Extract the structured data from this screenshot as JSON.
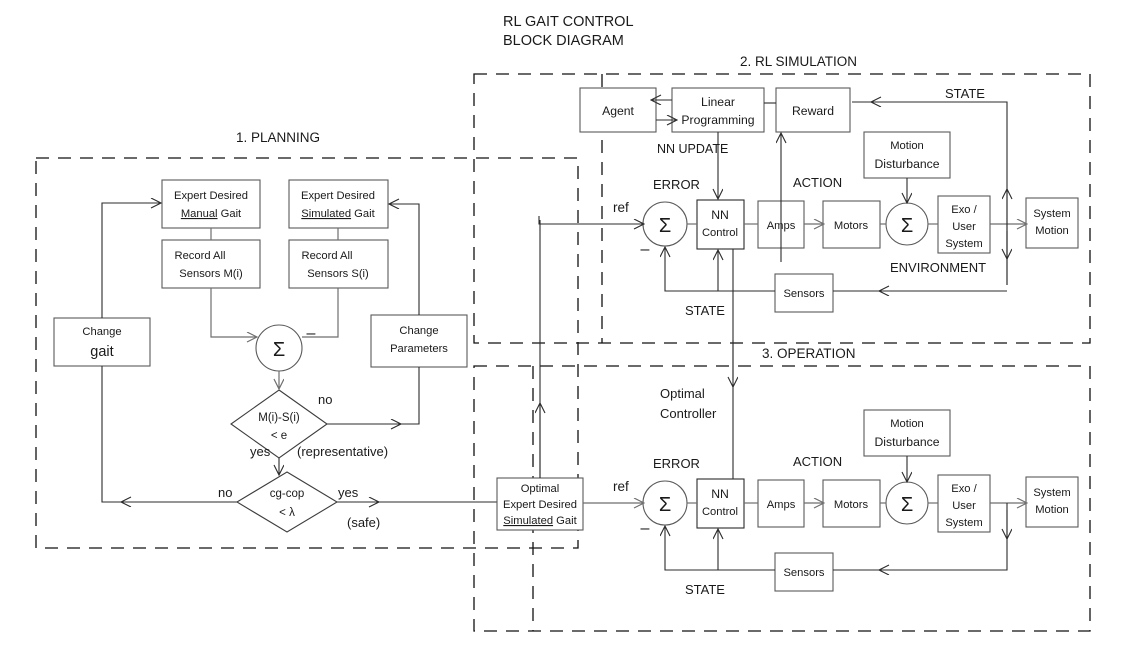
{
  "title": {
    "line1": "RL GAIT CONTROL",
    "line2": "BLOCK DIAGRAM"
  },
  "sections": {
    "planning": {
      "heading": "1.  PLANNING"
    },
    "simulation": {
      "heading": "2. RL SIMULATION"
    },
    "operation": {
      "heading": "3. OPERATION"
    }
  },
  "planning": {
    "boxes": {
      "expert_manual": {
        "line1": "Expert  Desired",
        "line2_underline": "Manual",
        "line2_rest": " Gait"
      },
      "expert_simulated": {
        "line1": "Expert  Desired",
        "line2_underline": "Simulated",
        "line2_rest": " Gait"
      },
      "record_m": {
        "line1": "Record All",
        "line2": "Sensors  M(i)"
      },
      "record_s": {
        "line1": "Record All",
        "line2": "Sensors  S(i)"
      },
      "change_gait": {
        "line1": "Change",
        "line2": "gait"
      },
      "change_parameters": {
        "line1": "Change",
        "line2": "Parameters"
      }
    },
    "sum_symbol": "Σ",
    "minus_sign": "–",
    "decisions": {
      "d1": {
        "line1": "M(i)-S(i)",
        "line2": "< e"
      },
      "d2": {
        "line1": "cg-cop",
        "line2": "< λ"
      }
    },
    "labels": {
      "no1": "no",
      "yes1": "yes",
      "representative": "(representative)",
      "no2": "no",
      "yes2": "yes",
      "safe": "(safe)"
    }
  },
  "simulation": {
    "boxes": {
      "agent": "Agent",
      "linear_programming": {
        "line1": "Linear",
        "line2": "Programming"
      },
      "reward": "Reward",
      "motion_disturbance": {
        "line1": "Motion",
        "line2": "Disturbance"
      },
      "nn_control": {
        "line1": "NN",
        "line2": "Control"
      },
      "amps": "Amps",
      "motors": "Motors",
      "exo_user_system": {
        "line1": "Exo /",
        "line2": "User",
        "line3": "System"
      },
      "system_motion": {
        "line1": "System",
        "line2": "Motion"
      },
      "sensors": "Sensors"
    },
    "sum_symbol": "Σ",
    "minus_sign": "–",
    "labels": {
      "nn_update": "NN UPDATE",
      "error": "ERROR",
      "action": "ACTION",
      "state_top": "STATE",
      "state_bottom": "STATE",
      "environment": "ENVIRONMENT",
      "ref": "ref"
    }
  },
  "operation": {
    "boxes": {
      "optimal_expert": {
        "line0": "Optimal",
        "line1": "Expert  Desired",
        "line2_underline": "Simulated",
        "line2_rest": " Gait"
      },
      "motion_disturbance": {
        "line1": "Motion",
        "line2": "Disturbance"
      },
      "nn_control": {
        "line1": "NN",
        "line2": "Control"
      },
      "amps": "Amps",
      "motors": "Motors",
      "exo_user_system": {
        "line1": "Exo /",
        "line2": "User",
        "line3": "System"
      },
      "system_motion": {
        "line1": "System",
        "line2": "Motion"
      },
      "sensors": "Sensors"
    },
    "sum_symbol": "Σ",
    "minus_sign": "–",
    "labels": {
      "optimal_controller": {
        "line1": "Optimal",
        "line2": "Controller"
      },
      "error": "ERROR",
      "action": "ACTION",
      "state_bottom": "STATE",
      "ref": "ref"
    }
  },
  "colors": {
    "background": "#ffffff",
    "stroke": "#2b2b2b",
    "box_stroke": "#5a5a5a",
    "text": "#1a1a1a"
  }
}
